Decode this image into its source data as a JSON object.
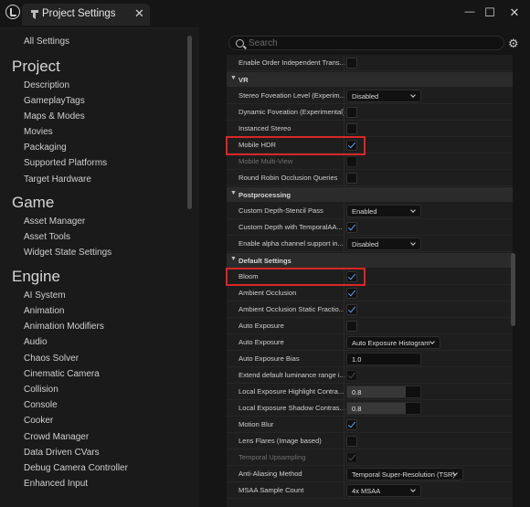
{
  "window": {
    "tab_title": "Project Settings",
    "close_glyph": "✕",
    "minimize_glyph": "—",
    "maximize_glyph": "☐",
    "window_close_glyph": "✕"
  },
  "sidebar": {
    "all_settings": "All Settings",
    "project_header": "Project",
    "project_items": [
      "Description",
      "GameplayTags",
      "Maps & Modes",
      "Movies",
      "Packaging",
      "Supported Platforms",
      "Target Hardware"
    ],
    "game_header": "Game",
    "game_items": [
      "Asset Manager",
      "Asset Tools",
      "Widget State Settings"
    ],
    "engine_header": "Engine",
    "engine_items": [
      "AI System",
      "Animation",
      "Animation Modifiers",
      "Audio",
      "Chaos Solver",
      "Cinematic Camera",
      "Collision",
      "Console",
      "Cooker",
      "Crowd Manager",
      "Data Driven CVars",
      "Debug Camera Controller",
      "Enhanced Input"
    ]
  },
  "search": {
    "placeholder": "Search"
  },
  "settings": {
    "rows": {
      "r0": "Enable Order Independent Trans...",
      "vr": "VR",
      "r1": "Stereo Foveation Level (Experim...",
      "r1_val": "Disabled",
      "r2": "Dynamic Foveation (Experimental)",
      "r3": "Instanced Stereo",
      "r4": "Mobile HDR",
      "r5": "Mobile Multi-View",
      "r6": "Round Robin Occlusion Queries",
      "post": "Postprocessing",
      "r7": "Custom Depth-Stencil Pass",
      "r7_val": "Enabled",
      "r8": "Custom Depth with TemporalAA...",
      "r9": "Enable alpha channel support in...",
      "r9_val": "Disabled",
      "defaults": "Default Settings",
      "r10": "Bloom",
      "r11": "Ambient Occlusion",
      "r12": "Ambient Occlusion Static Fractio...",
      "r13": "Auto Exposure",
      "r14": "Auto Exposure",
      "r14_val": "Auto Exposure Histogram",
      "r15": "Auto Exposure Bias",
      "r15_val": "1.0",
      "r16": "Extend default luminance range i...",
      "r17": "Local Exposure Highlight Contra...",
      "r17_val": "0.8",
      "r18": "Local Exposure Shadow Contras...",
      "r18_val": "0.8",
      "r19": "Motion Blur",
      "r20": "Lens Flares (Image based)",
      "r21": "Temporal Upsampling",
      "r22": "Anti-Aliasing Method",
      "r22_val": "Temporal Super-Resolution (TSR)",
      "r23": "MSAA Sample Count",
      "r23_val": "4x MSAA"
    },
    "local_exposure_highlight_fraction": 0.8,
    "local_exposure_shadow_fraction": 0.8
  },
  "colors": {
    "highlight": "#d92626",
    "check": "#5ea0f0"
  }
}
